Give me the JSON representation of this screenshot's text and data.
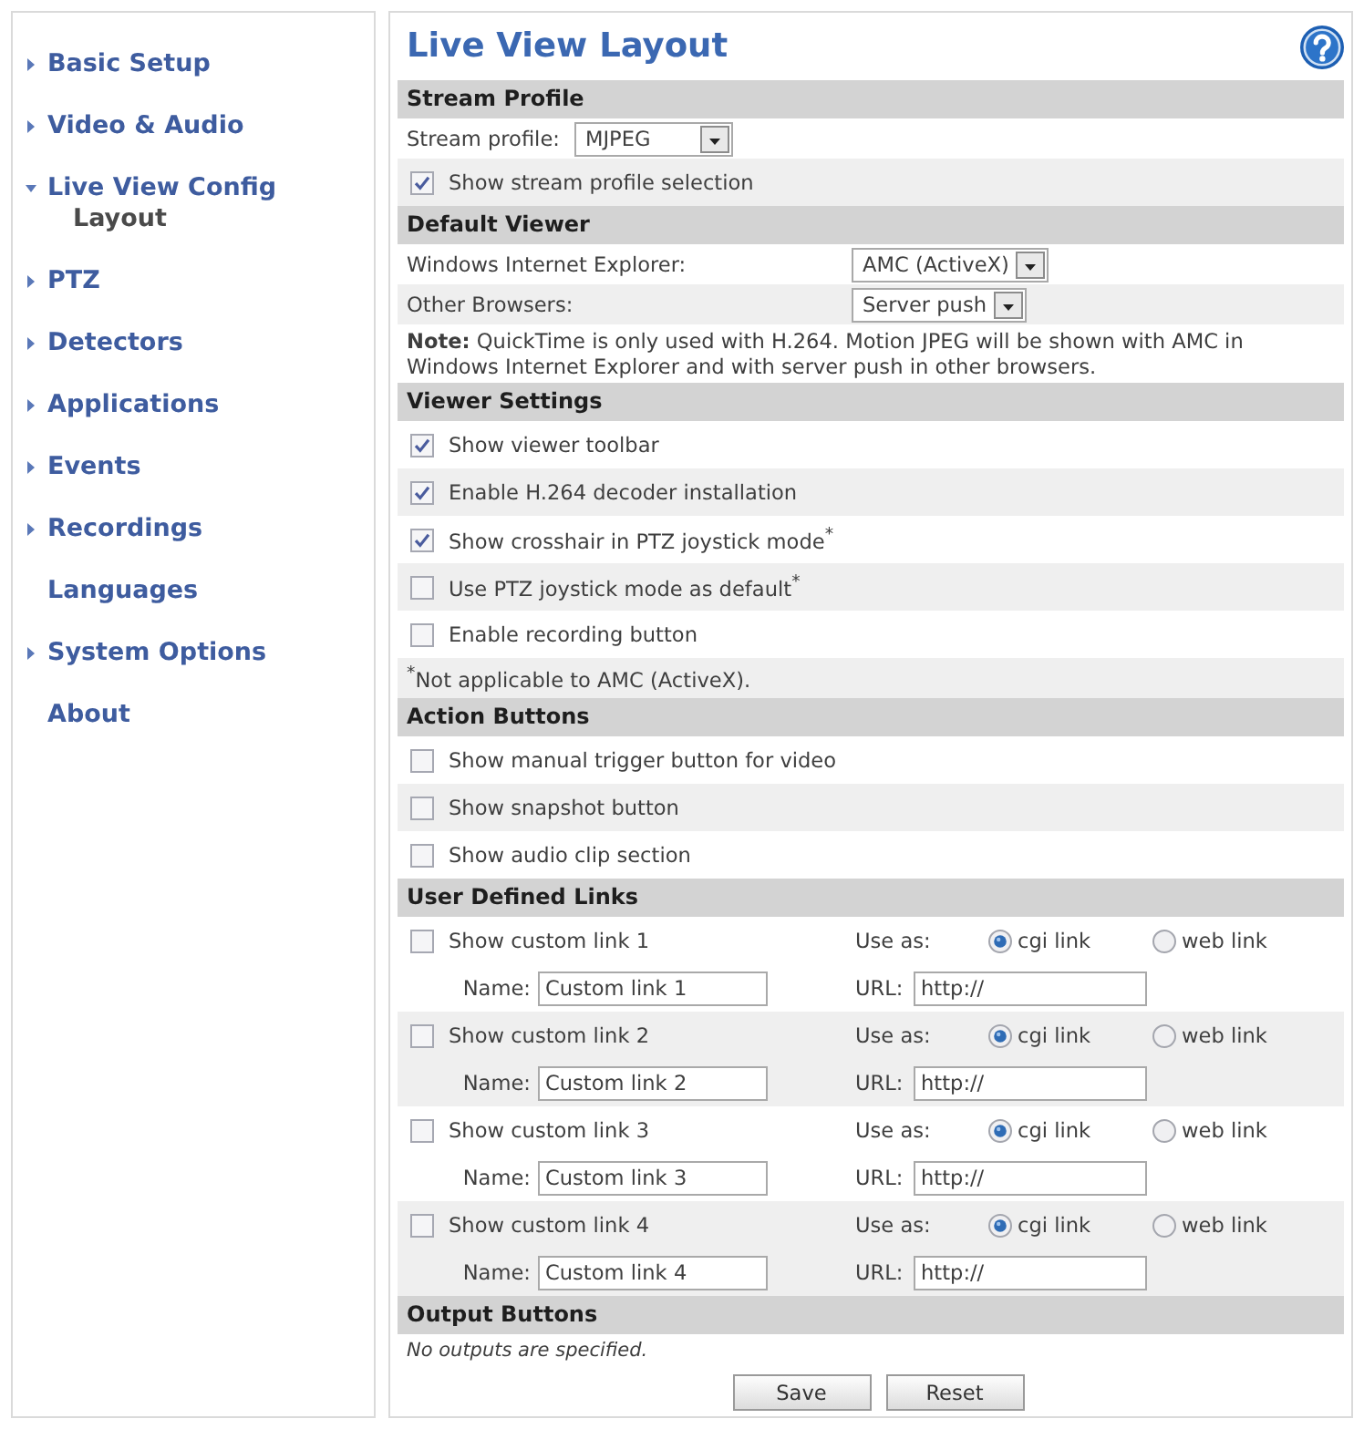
{
  "sidebar": {
    "items": [
      {
        "kind": "group",
        "label": "Basic Setup",
        "expanded": false,
        "selected": false
      },
      {
        "kind": "group",
        "label": "Video & Audio",
        "expanded": false,
        "selected": false
      },
      {
        "kind": "group",
        "label": "Live View Config",
        "expanded": true,
        "selected": false,
        "children": [
          {
            "label": "Layout",
            "selected": true
          }
        ]
      },
      {
        "kind": "group",
        "label": "PTZ",
        "expanded": false,
        "selected": false
      },
      {
        "kind": "group",
        "label": "Detectors",
        "expanded": false,
        "selected": false
      },
      {
        "kind": "group",
        "label": "Applications",
        "expanded": false,
        "selected": false
      },
      {
        "kind": "group",
        "label": "Events",
        "expanded": false,
        "selected": false
      },
      {
        "kind": "group",
        "label": "Recordings",
        "expanded": false,
        "selected": false
      },
      {
        "kind": "page",
        "label": "Languages",
        "selected": false
      },
      {
        "kind": "group",
        "label": "System Options",
        "expanded": false,
        "selected": false
      },
      {
        "kind": "page",
        "label": "About",
        "selected": false
      }
    ]
  },
  "page": {
    "title": "Live View Layout"
  },
  "sections": [
    {
      "title": "Stream Profile",
      "rows": [
        {
          "kind": "select",
          "label": "Stream profile:",
          "value": "MJPEG"
        },
        {
          "kind": "checkbox",
          "label": "Show stream profile selection",
          "checked": true
        }
      ]
    },
    {
      "title": "Default Viewer",
      "rows": [
        {
          "kind": "browser",
          "label": "Windows Internet Explorer:",
          "value": "AMC (ActiveX)"
        },
        {
          "kind": "browser",
          "label": "Other Browsers:",
          "value": "Server push"
        },
        {
          "kind": "note",
          "text": "**Note:** QuickTime is only used with H.264. Motion JPEG will be shown with AMC in Windows Internet Explorer and with server push in other browsers."
        }
      ]
    },
    {
      "title": "Viewer Settings",
      "rows": [
        {
          "kind": "checkbox",
          "label": "Show viewer toolbar",
          "checked": true
        },
        {
          "kind": "checkbox",
          "label": "Enable H.264 decoder installation",
          "checked": true
        },
        {
          "kind": "checkbox",
          "label": "Show crosshair in PTZ joystick mode$^{*}$",
          "checked": true
        },
        {
          "kind": "checkbox",
          "label": "Use PTZ joystick mode as default$^{*}$",
          "checked": false
        },
        {
          "kind": "checkbox",
          "label": "Enable recording button",
          "checked": false
        },
        {
          "kind": "footnote",
          "text": "$^{*}$Not applicable to AMC (ActiveX)."
        }
      ]
    },
    {
      "title": "Action Buttons",
      "rows": [
        {
          "kind": "checkbox",
          "label": "Show manual trigger button for video",
          "checked": false
        },
        {
          "kind": "checkbox",
          "label": "Show snapshot button",
          "checked": false
        },
        {
          "kind": "checkbox",
          "label": "Show audio clip section",
          "checked": false
        }
      ]
    },
    {
      "title": "User Defined Links",
      "rows": [
        {
          "kind": "link",
          "label": "Show custom link 1",
          "checked": false,
          "use_as": "Use as:",
          "options": [
            {
              "label": "cgi link",
              "selected": true
            },
            {
              "label": "web link",
              "selected": false
            }
          ],
          "name_label": "Name:",
          "name_value": "Custom link 1",
          "url_label": "URL:",
          "url_value": "http://"
        },
        {
          "kind": "link",
          "label": "Show custom link 2",
          "checked": false,
          "use_as": "Use as:",
          "options": [
            {
              "label": "cgi link",
              "selected": true
            },
            {
              "label": "web link",
              "selected": false
            }
          ],
          "name_label": "Name:",
          "name_value": "Custom link 2",
          "url_label": "URL:",
          "url_value": "http://"
        },
        {
          "kind": "link",
          "label": "Show custom link 3",
          "checked": false,
          "use_as": "Use as:",
          "options": [
            {
              "label": "cgi link",
              "selected": true
            },
            {
              "label": "web link",
              "selected": false
            }
          ],
          "name_label": "Name:",
          "name_value": "Custom link 3",
          "url_label": "URL:",
          "url_value": "http://"
        },
        {
          "kind": "link",
          "label": "Show custom link 4",
          "checked": false,
          "use_as": "Use as:",
          "options": [
            {
              "label": "cgi link",
              "selected": true
            },
            {
              "label": "web link",
              "selected": false
            }
          ],
          "name_label": "Name:",
          "name_value": "Custom link 4",
          "url_label": "URL:",
          "url_value": "http://"
        }
      ]
    },
    {
      "title": "Output Buttons",
      "rows": [
        {
          "kind": "empty",
          "text": "No outputs are specified."
        }
      ]
    }
  ],
  "buttons": [
    "Save",
    "Reset"
  ]
}
